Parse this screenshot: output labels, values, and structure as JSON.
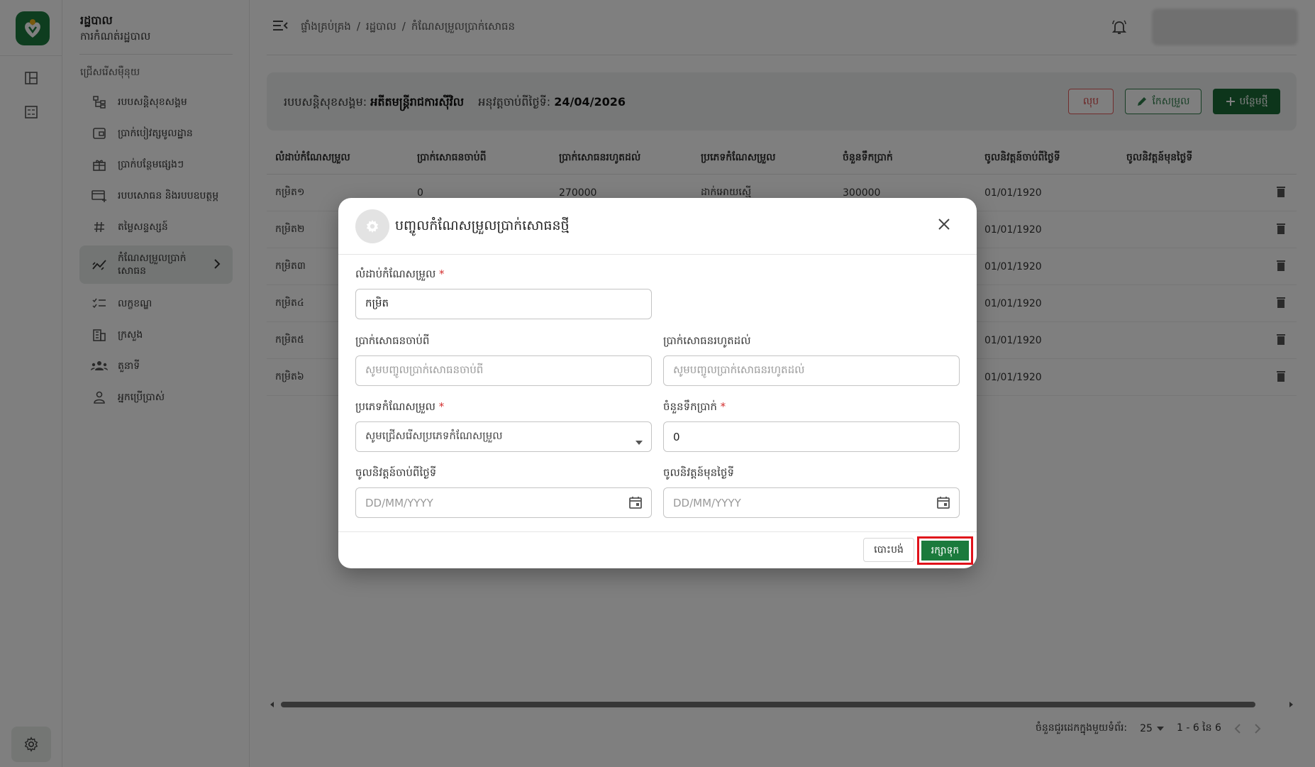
{
  "app": {
    "title": "រដ្ឋបាល",
    "subtitle": "ការកំណត់រដ្ឋបាល"
  },
  "sidebar": {
    "section_label": "ជ្រើសរើសម៉ឺនុយ",
    "items": [
      {
        "label": "របបសន្តិសុខសង្គម",
        "icon": "hierarchy-icon"
      },
      {
        "label": "ប្រាក់បៀវត្សមូលដ្ឋាន",
        "icon": "wallet-icon"
      },
      {
        "label": "ប្រាក់បន្ថែមផ្សេងៗ",
        "icon": "gift-icon"
      },
      {
        "label": "របបសោធន និងរបបឧបត្ថម្ភ",
        "icon": "card-plus-icon"
      },
      {
        "label": "តម្លៃសន្ទស្សន៍",
        "icon": "hash-icon"
      },
      {
        "label": "កំណែសម្រួលប្រាក់សោធន",
        "icon": "trend-icon"
      },
      {
        "label": "លក្ខខណ្ឌ",
        "icon": "checklist-icon"
      },
      {
        "label": "ក្រសួង",
        "icon": "building-icon"
      },
      {
        "label": "តួនាទី",
        "icon": "group-icon"
      },
      {
        "label": "អ្នកប្រើប្រាស់",
        "icon": "person-icon"
      }
    ]
  },
  "breadcrumb": [
    "ផ្ទាំងគ្រប់គ្រង",
    "/",
    "រដ្ឋបាល",
    "/",
    "កំណែសម្រួលប្រាក់សោធន"
  ],
  "info": {
    "scheme_label": "របបសន្តិសុខសង្គម:",
    "scheme_value": "អតីតមន្ត្រីរាជការស៊ីវិល",
    "effective_label": "អនុវត្តចាប់ពីថ្ងៃទី:",
    "effective_value": "24/04/2026",
    "delete_label": "លុប",
    "edit_label": "កែសម្រួល",
    "add_label": "បន្ថែមថ្មី"
  },
  "table": {
    "headers": [
      "លំដាប់កំណែសម្រួល",
      "ប្រាក់សោធនចាប់ពី",
      "ប្រាក់សោធនរហូតដល់",
      "ប្រភេទកំណែសម្រួល",
      "ចំនួនទឹកប្រាក់",
      "ចូលនិវត្តន៍ចាប់ពីថ្ងៃទី",
      "ចូលនិវត្តន៍មុនថ្ងៃទី"
    ],
    "rows": [
      [
        "កម្រិត១",
        "0",
        "270000",
        "ដាក់អោយស្មើ",
        "300000",
        "01/01/1920",
        ""
      ],
      [
        "កម្រិត២",
        "",
        "",
        "",
        "",
        "01/01/1920",
        ""
      ],
      [
        "កម្រិត៣",
        "",
        "",
        "",
        "",
        "01/01/1920",
        ""
      ],
      [
        "កម្រិត៤",
        "",
        "",
        "",
        "",
        "01/01/1920",
        ""
      ],
      [
        "កម្រិត៥",
        "",
        "",
        "",
        "",
        "01/01/1920",
        ""
      ],
      [
        "កម្រិត៦",
        "",
        "",
        "",
        "",
        "01/01/1920",
        ""
      ]
    ]
  },
  "pagination": {
    "rows_per_page_label": "ចំនួនជួរដេកក្នុងមួយទំព័រ:",
    "rows_per_page": "25",
    "range": "1 - 6 នៃ 6"
  },
  "modal": {
    "title": "បញ្ចូលកំណែសម្រួលប្រាក់សោធនថ្មី",
    "fields": {
      "order_label": "លំដាប់កំណែសម្រួល",
      "order_value": "កម្រិត",
      "from_label": "ប្រាក់សោធនចាប់ពី",
      "from_placeholder": "សូមបញ្ចូលប្រាក់សោធនចាប់ពី",
      "to_label": "ប្រាក់សោធនរហូតដល់",
      "to_placeholder": "សូមបញ្ចូលប្រាក់សោធនរហូតដល់",
      "type_label": "ប្រភេទកំណែសម្រួល",
      "type_placeholder": "សូមជ្រើសរើសប្រភេទកំណែសម្រួល",
      "amount_label": "ចំនួនទឹកប្រាក់",
      "amount_value": "0",
      "retire_from_label": "ចូលនិវត្តន៍ចាប់ពីថ្ងៃទី",
      "retire_from_placeholder": "DD/MM/YYYY",
      "retire_before_label": "ចូលនិវត្តន៍មុនថ្ងៃទី",
      "retire_before_placeholder": "DD/MM/YYYY",
      "required_mark": "*"
    },
    "cancel_label": "បោះបង់",
    "save_label": "រក្សាទុក"
  },
  "colors": {
    "primary": "#1b6b37",
    "danger": "#d64545",
    "highlight": "#e0121b"
  }
}
